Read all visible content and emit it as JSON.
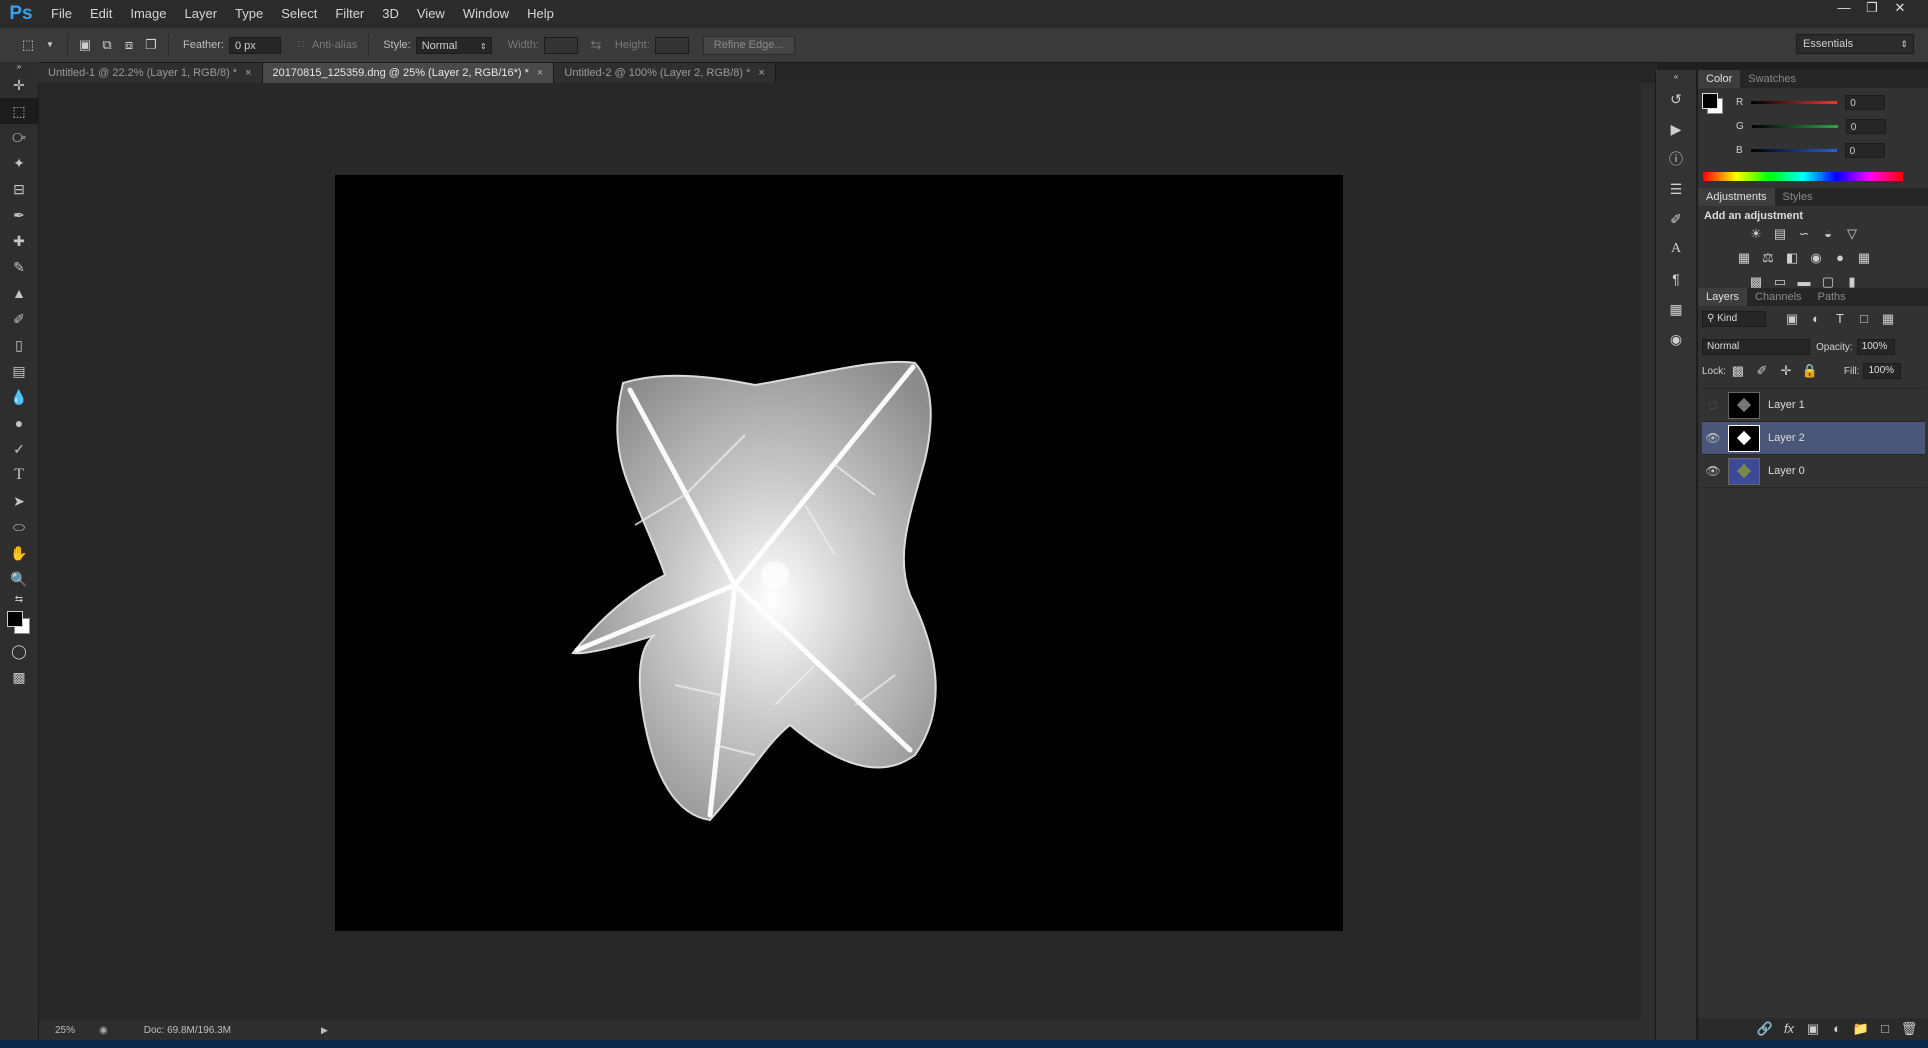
{
  "app": {
    "logo": "Ps"
  },
  "menu": [
    "File",
    "Edit",
    "Image",
    "Layer",
    "Type",
    "Select",
    "Filter",
    "3D",
    "View",
    "Window",
    "Help"
  ],
  "options_bar": {
    "feather_label": "Feather:",
    "feather_value": "0 px",
    "antialias_label": "Anti-alias",
    "style_label": "Style:",
    "style_value": "Normal",
    "width_label": "Width:",
    "height_label": "Height:",
    "refine_edge_label": "Refine Edge...",
    "workspace": "Essentials"
  },
  "tabs": [
    {
      "title": "Untitled-1 @ 22.2% (Layer 1, RGB/8) *",
      "active": false
    },
    {
      "title": "20170815_125359.dng @ 25% (Layer 2, RGB/16*) *",
      "active": true
    },
    {
      "title": "Untitled-2 @ 100% (Layer 2, RGB/8) *",
      "active": false
    }
  ],
  "status": {
    "zoom": "25%",
    "doc": "Doc: 69.8M/196.3M"
  },
  "color_panel": {
    "tabs": [
      "Color",
      "Swatches"
    ],
    "channels": [
      {
        "label": "R",
        "value": "0",
        "color": "#e53935"
      },
      {
        "label": "G",
        "value": "0",
        "color": "#2aa84a"
      },
      {
        "label": "B",
        "value": "0",
        "color": "#2a5de0"
      }
    ]
  },
  "adjustments_panel": {
    "tabs": [
      "Adjustments",
      "Styles"
    ],
    "heading": "Add an adjustment"
  },
  "layers_panel": {
    "tabs": [
      "Layers",
      "Channels",
      "Paths"
    ],
    "filter_kind": "Kind",
    "blend_mode": "Normal",
    "opacity_label": "Opacity:",
    "opacity_value": "100%",
    "lock_label": "Lock:",
    "fill_label": "Fill:",
    "fill_value": "100%",
    "layers": [
      {
        "name": "Layer 1",
        "visible": false,
        "selected": false
      },
      {
        "name": "Layer 2",
        "visible": true,
        "selected": true
      },
      {
        "name": "Layer 0",
        "visible": true,
        "selected": false
      }
    ]
  },
  "colors": {
    "accent": "#3aa0f0",
    "selection": "#4b5778"
  }
}
